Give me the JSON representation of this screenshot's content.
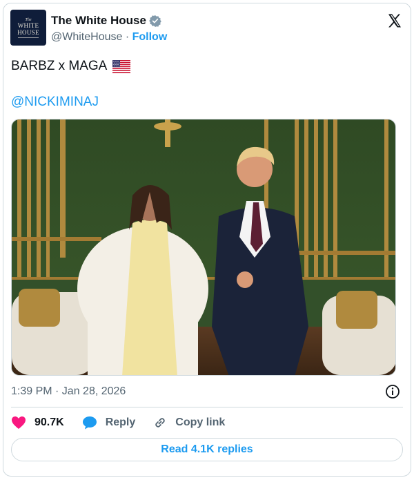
{
  "author": {
    "avatar_text_small": "The",
    "avatar_text_line1": "WHITE",
    "avatar_text_line2": "HOUSE",
    "name": "The White House",
    "handle": "@WhiteHouse",
    "separator": " · ",
    "follow_label": "Follow"
  },
  "tweet": {
    "text": "BARBZ x MAGA",
    "mention": "@NICKIMINAJ",
    "timestamp": "1:39 PM · Jan 28, 2026"
  },
  "actions": {
    "likes": "90.7K",
    "reply_label": "Reply",
    "copy_label": "Copy link",
    "read_replies_label": "Read 4.1K replies"
  },
  "icons": {
    "verified": "verified-badge-icon",
    "platform": "x-logo-icon",
    "flag": "us-flag-icon",
    "info": "info-icon",
    "like": "heart-icon",
    "reply": "reply-bubble-icon",
    "copy": "link-icon"
  },
  "colors": {
    "accent": "#1d9bf0",
    "like": "#f91880",
    "muted": "#536471",
    "border": "#cfd9de"
  }
}
